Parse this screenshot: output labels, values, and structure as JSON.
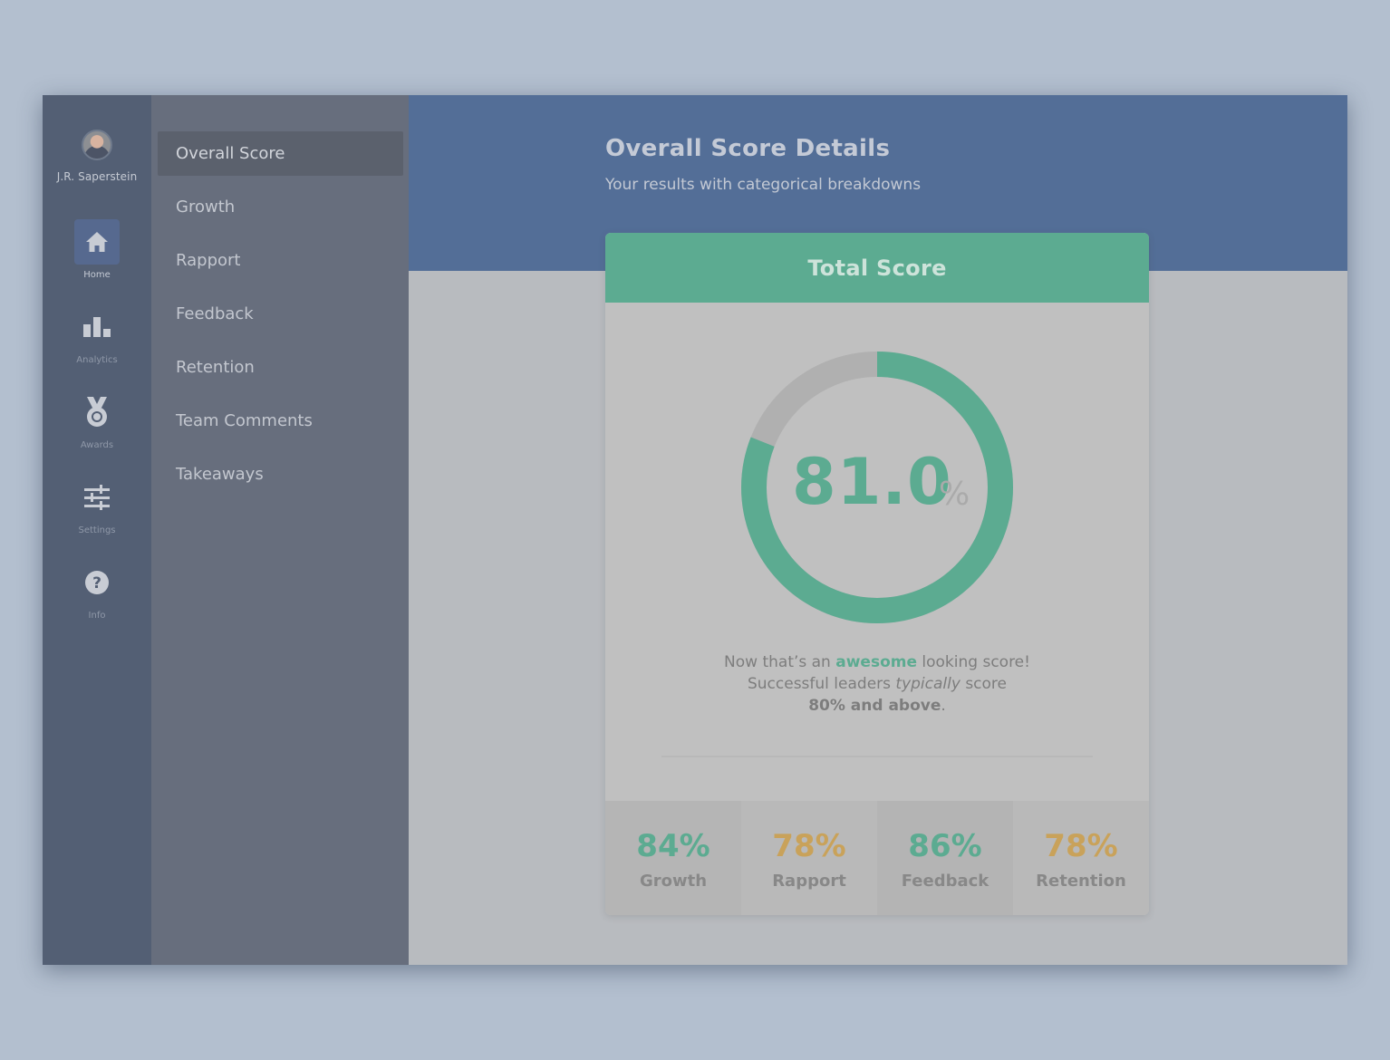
{
  "user": {
    "name": "J.R. Saperstein"
  },
  "rail": {
    "items": [
      {
        "label": "Home",
        "icon": "home-icon",
        "active": true
      },
      {
        "label": "Analytics",
        "icon": "bar-chart-icon",
        "active": false
      },
      {
        "label": "Awards",
        "icon": "medal-icon",
        "active": false
      },
      {
        "label": "Settings",
        "icon": "sliders-icon",
        "active": false
      },
      {
        "label": "Info",
        "icon": "help-icon",
        "active": false
      }
    ]
  },
  "submenu": {
    "items": [
      {
        "label": "Overall Score",
        "active": true
      },
      {
        "label": "Growth"
      },
      {
        "label": "Rapport"
      },
      {
        "label": "Feedback"
      },
      {
        "label": "Retention"
      },
      {
        "label": "Team Comments"
      },
      {
        "label": "Takeaways"
      }
    ]
  },
  "header": {
    "title": "Overall Score Details",
    "subtitle": "Your results with categorical breakdowns"
  },
  "card": {
    "title": "Total Score",
    "score": "81.0",
    "score_unit": "%",
    "score_fraction": 0.81,
    "message": {
      "line1_pre": "Now that’s an ",
      "line1_accent": "awesome",
      "line1_post": " looking score!",
      "line2_pre": "Successful leaders ",
      "line2_em": "typically",
      "line2_post": " score",
      "line3_strong": "80% and above",
      "line3_post": "."
    },
    "stats": [
      {
        "value": "84%",
        "label": "Growth",
        "color": "#5cab91"
      },
      {
        "value": "78%",
        "label": "Rapport",
        "color": "#c9a25a"
      },
      {
        "value": "86%",
        "label": "Feedback",
        "color": "#5cab91"
      },
      {
        "value": "78%",
        "label": "Retention",
        "color": "#c9a25a"
      }
    ]
  },
  "colors": {
    "accent_green": "#5cab91",
    "accent_gold": "#c9a25a",
    "banner_blue": "#536e97"
  }
}
